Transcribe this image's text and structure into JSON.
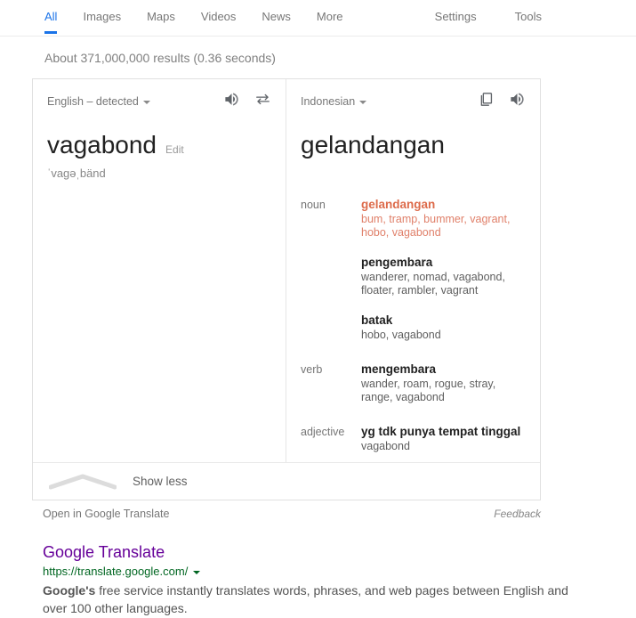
{
  "nav": {
    "tabs": [
      {
        "label": "All",
        "active": true
      },
      {
        "label": "Images",
        "active": false
      },
      {
        "label": "Maps",
        "active": false
      },
      {
        "label": "Videos",
        "active": false
      },
      {
        "label": "News",
        "active": false
      },
      {
        "label": "More",
        "active": false
      }
    ],
    "settings_label": "Settings",
    "tools_label": "Tools"
  },
  "result_stats": "About 371,000,000 results (0.36 seconds)",
  "translate_card": {
    "source": {
      "language_label": "English – detected",
      "word": "vagabond",
      "edit_label": "Edit",
      "phonetic": "ˈvaɡəˌbänd",
      "listen_icon": "speaker-icon",
      "swap_icon": "swap-languages-icon"
    },
    "target": {
      "language_label": "Indonesian",
      "word": "gelandangan",
      "copy_icon": "copy-icon",
      "listen_icon": "speaker-icon"
    },
    "definitions": [
      {
        "pos": "noun",
        "entries": [
          {
            "term": "gelandangan",
            "synonyms": "bum, tramp, bummer, vagrant, hobo, vagabond",
            "primary": true
          },
          {
            "term": "pengembara",
            "synonyms": "wanderer, nomad, vagabond, floater, rambler, vagrant",
            "primary": false
          },
          {
            "term": "batak",
            "synonyms": "hobo, vagabond",
            "primary": false
          }
        ]
      },
      {
        "pos": "verb",
        "entries": [
          {
            "term": "mengembara",
            "synonyms": "wander, roam, rogue, stray, range, vagabond",
            "primary": false
          }
        ]
      },
      {
        "pos": "adjective",
        "entries": [
          {
            "term": "yg tdk punya tempat tinggal",
            "synonyms": "vagabond",
            "primary": false
          }
        ]
      }
    ],
    "show_less_label": "Show less",
    "show_less_icon": "chevron-up-icon",
    "open_in_translate_label": "Open in Google Translate",
    "feedback_label": "Feedback"
  },
  "organic_result": {
    "title": "Google Translate",
    "url": "https://translate.google.com/",
    "url_caret_icon": "chevron-down-icon",
    "snippet_bold": "Google's",
    "snippet_rest": " free service instantly translates words, phrases, and web pages between English and over 100 other languages."
  },
  "colors": {
    "accent_blue": "#1a73e8",
    "primary_translation": "#dd6b4b",
    "link_visited": "#660099",
    "url_green": "#006621"
  }
}
